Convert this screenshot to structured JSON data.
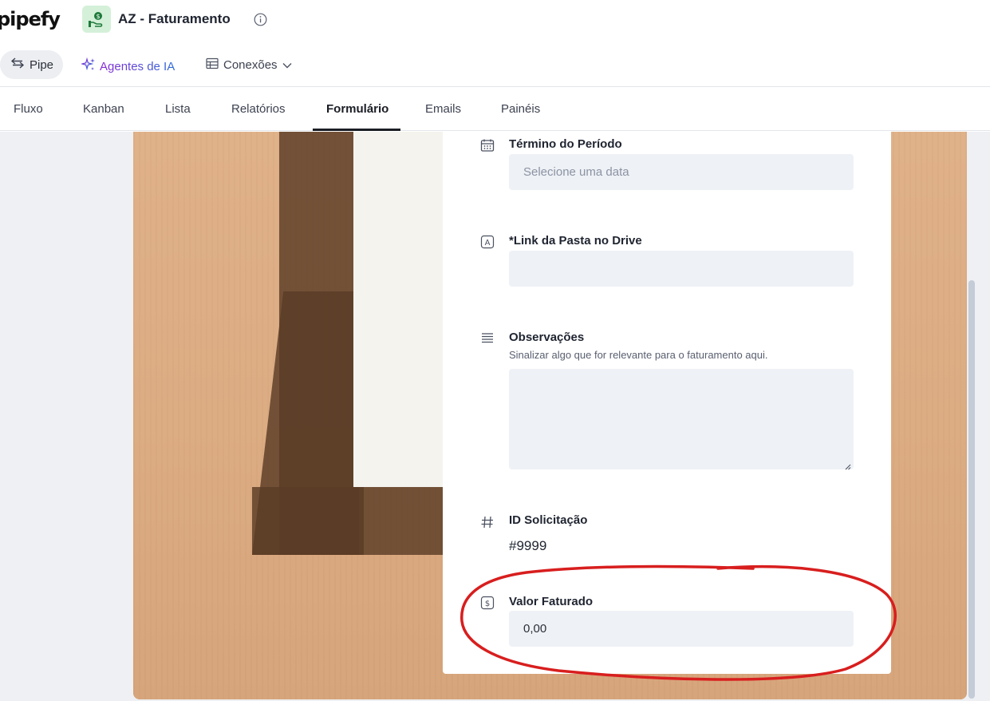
{
  "header": {
    "logo_text": "pipefy",
    "pipe_title": "AZ - Faturamento",
    "pipe_icon": "money-hand-icon",
    "info_icon": "info-icon"
  },
  "subnav": {
    "pipe_label": "Pipe",
    "agents_label": "Agentes de IA",
    "connections_label": "Conexões"
  },
  "tabs": [
    {
      "label": "Fluxo"
    },
    {
      "label": "Kanban"
    },
    {
      "label": "Lista"
    },
    {
      "label": "Relatórios"
    },
    {
      "label": "Formulário",
      "active": true
    },
    {
      "label": "Emails"
    },
    {
      "label": "Painéis"
    }
  ],
  "form": {
    "fields": [
      {
        "icon": "calendar-icon",
        "label": "Término do Período",
        "placeholder": "Selecione uma data",
        "value": ""
      },
      {
        "icon": "text-field-icon",
        "label": "*Link da Pasta no Drive",
        "value": ""
      },
      {
        "icon": "long-text-icon",
        "label": "Observações",
        "description": "Sinalizar algo que for relevante para o faturamento aqui.",
        "value": ""
      },
      {
        "icon": "hash-icon",
        "label": "ID Solicitação",
        "value": "#9999"
      },
      {
        "icon": "currency-icon",
        "label": "Valor Faturado",
        "value": "0,00"
      }
    ]
  },
  "colors": {
    "accent_green_bg": "#d4f0d9",
    "annotation_red": "#d81e1e",
    "agents_gradient_start": "#8a2bd6",
    "agents_gradient_end": "#2e6bd8"
  }
}
